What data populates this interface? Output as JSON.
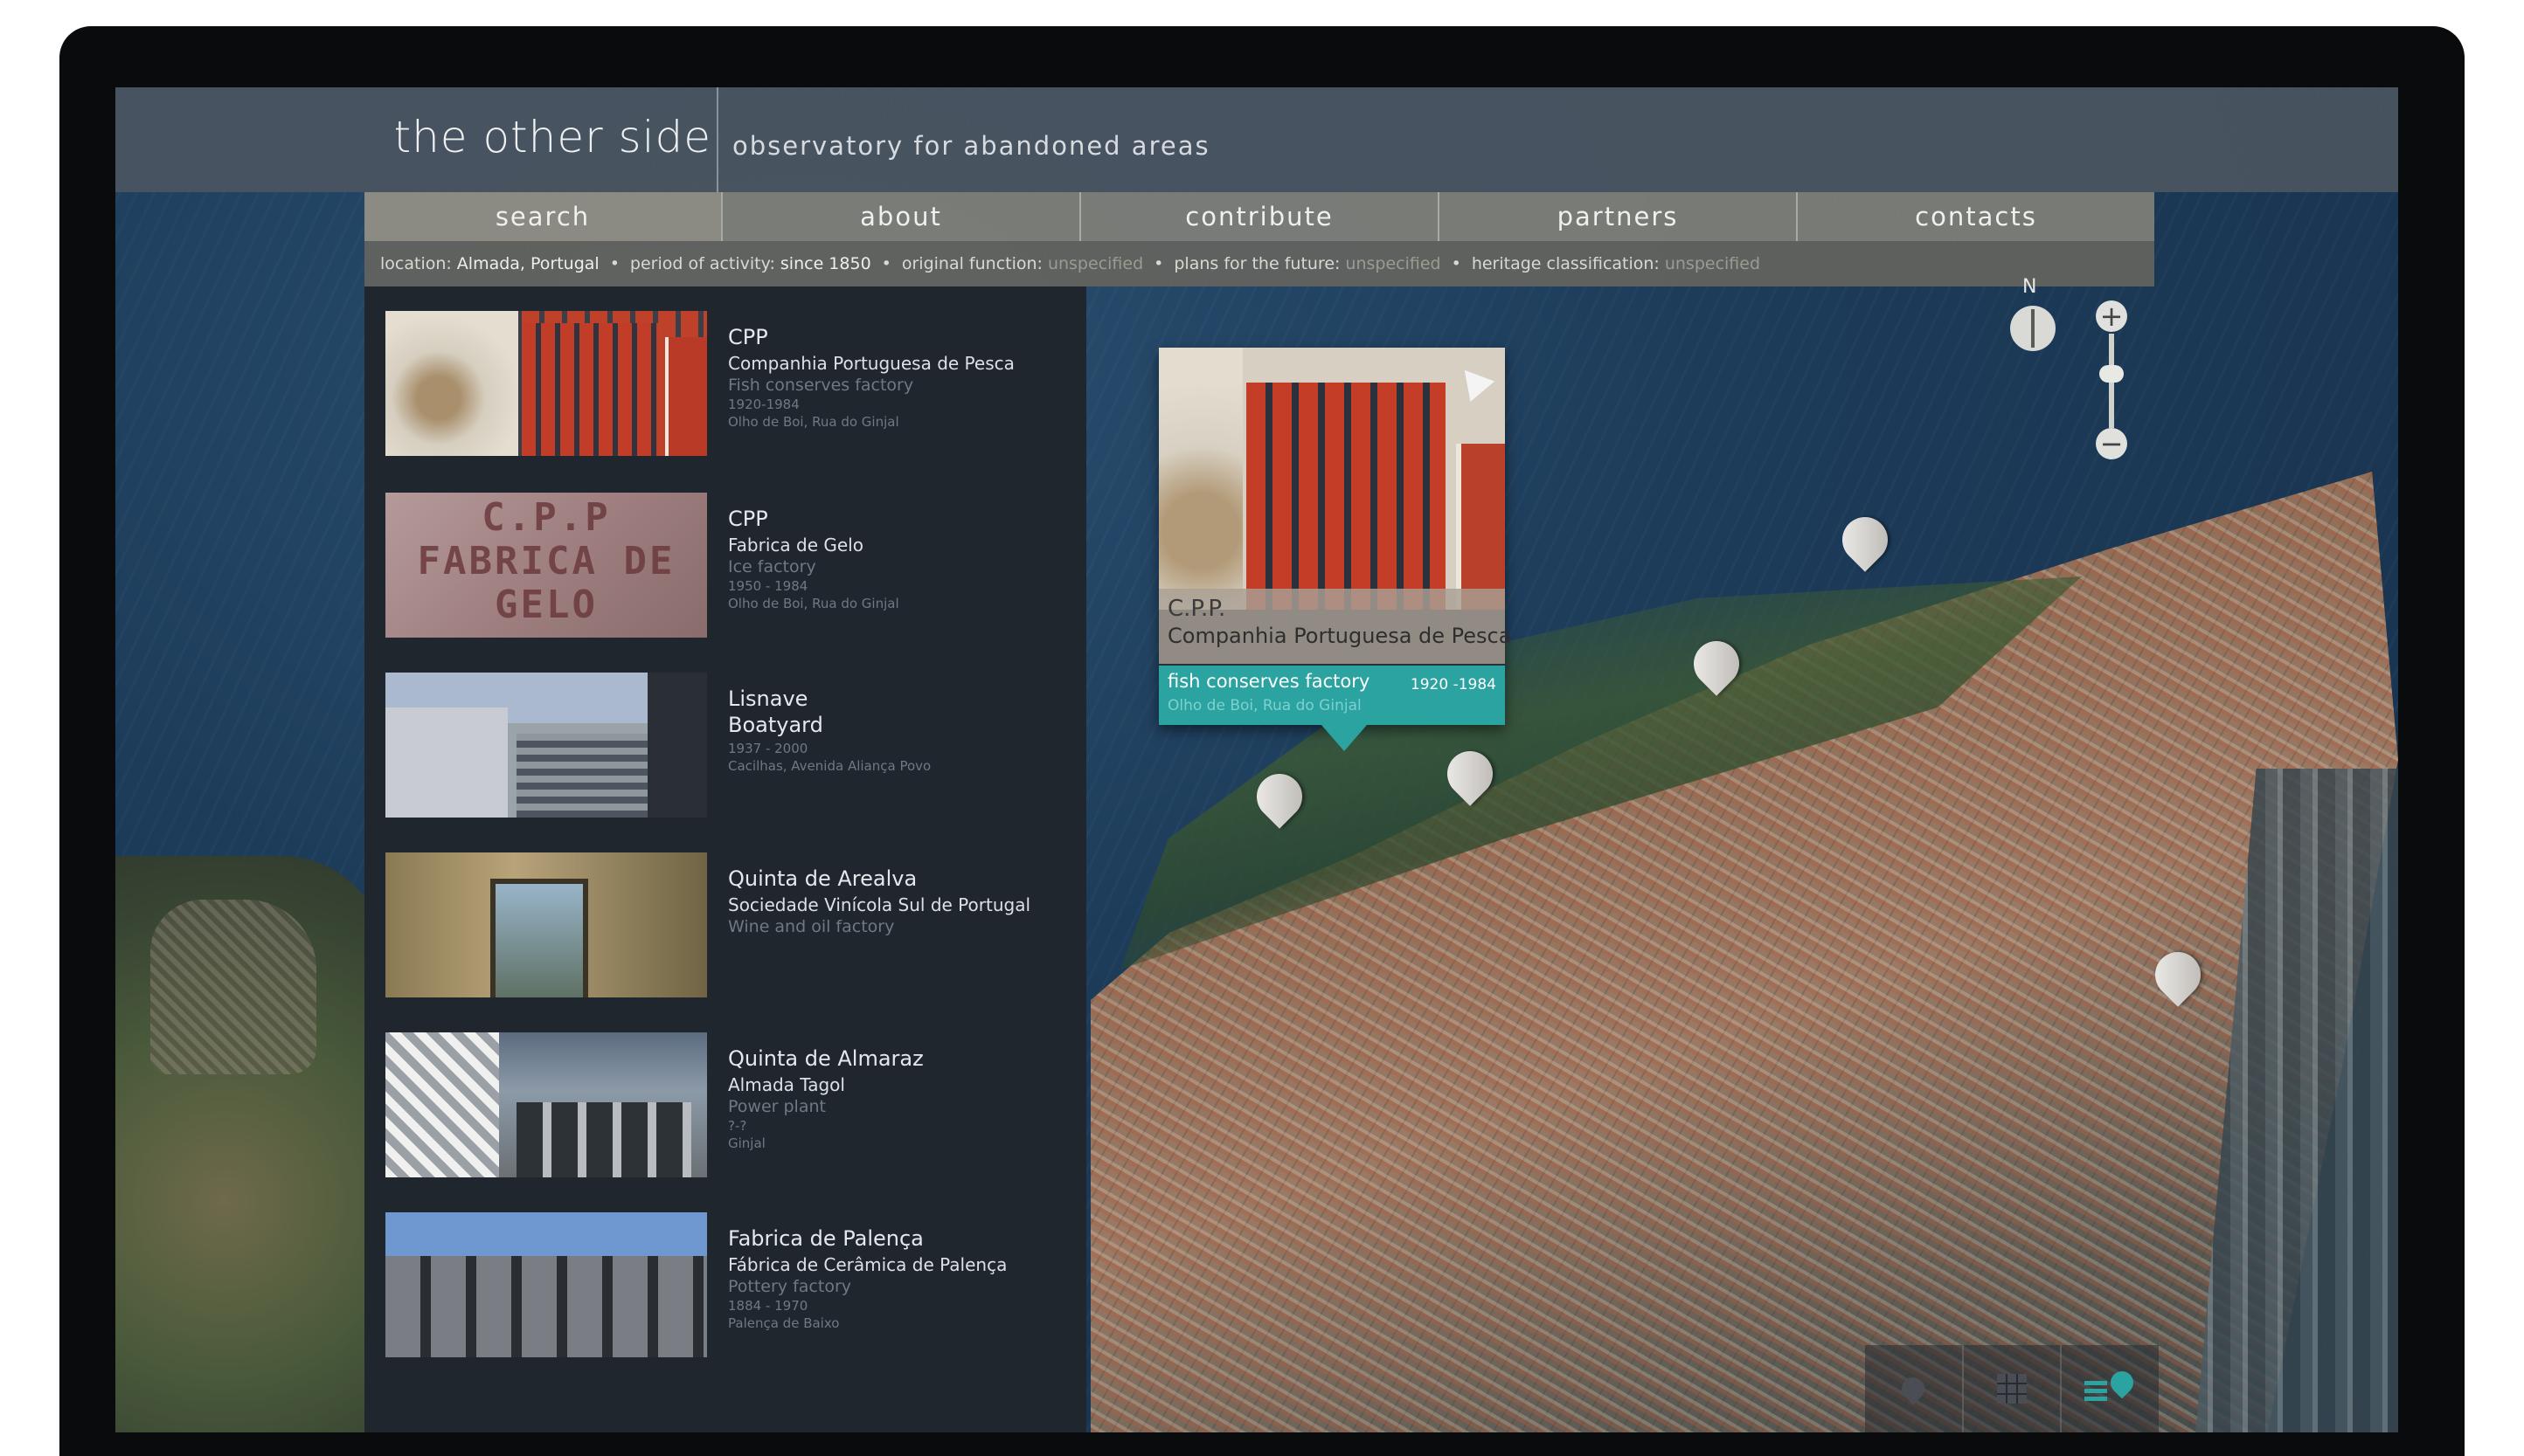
{
  "header": {
    "title": "the other side",
    "subtitle": "observatory for abandoned areas"
  },
  "nav": {
    "items": [
      {
        "label": "search"
      },
      {
        "label": "about"
      },
      {
        "label": "contribute"
      },
      {
        "label": "partners"
      },
      {
        "label": "contacts"
      }
    ]
  },
  "filters": {
    "location": {
      "label": "location:",
      "value": "Almada, Portugal"
    },
    "period": {
      "label": "period of activity:",
      "value": "since 1850"
    },
    "function": {
      "label": "original function:",
      "value": "unspecified"
    },
    "plans": {
      "label": "plans for the future:",
      "value": "unspecified"
    },
    "heritage": {
      "label": "heritage classification:",
      "value": "unspecified"
    }
  },
  "list": {
    "items": [
      {
        "title": "CPP",
        "subtitle": "Companhia Portuguesa de Pesca",
        "function": "Fish conserves factory",
        "dates": "1920-1984",
        "address": "Olho de Boi, Rua do Ginjal"
      },
      {
        "title": "CPP",
        "subtitle": "Fabrica de Gelo",
        "function": "Ice factory",
        "dates": "1950 - 1984",
        "address": "Olho de Boi, Rua do Ginjal",
        "thumb_text": "C.P.P FABRICA DE GELO"
      },
      {
        "title": "Lisnave",
        "subtitle": "Boatyard",
        "function": "",
        "dates": "1937 - 2000",
        "address": "Cacilhas, Avenida Aliança Povo"
      },
      {
        "title": "Quinta de Arealva",
        "subtitle": "Sociedade Vinícola Sul de Portugal",
        "function": "Wine and oil factory",
        "dates": "",
        "address": ""
      },
      {
        "title": "Quinta de Almaraz",
        "subtitle": "Almada Tagol",
        "function": "Power plant",
        "dates": "?-?",
        "address": "Ginjal"
      },
      {
        "title": "Fabrica de Palença",
        "subtitle": "Fábrica de Cerâmica de Palença",
        "function": "Pottery factory",
        "dates": "1884 - 1970",
        "address": "Palença de Baixo"
      }
    ]
  },
  "popup": {
    "code": "C.P.P.",
    "name": "Companhia Portuguesa de Pesca",
    "function": "fish conserves factory",
    "dates": "1920 -1984",
    "address": "Olho de Boi, Rua do Ginjal",
    "arrow_icon": "navigate-arrow-icon"
  },
  "map": {
    "compass_label": "N",
    "zoom_in": "+",
    "zoom_out": "−"
  },
  "view_modes": [
    "map-pin-icon",
    "grid-icon",
    "list-map-icon"
  ],
  "colors": {
    "accent": "#2aa3a1",
    "header": "#4a5460",
    "nav": "#80807a",
    "panel": "#1f262e"
  }
}
